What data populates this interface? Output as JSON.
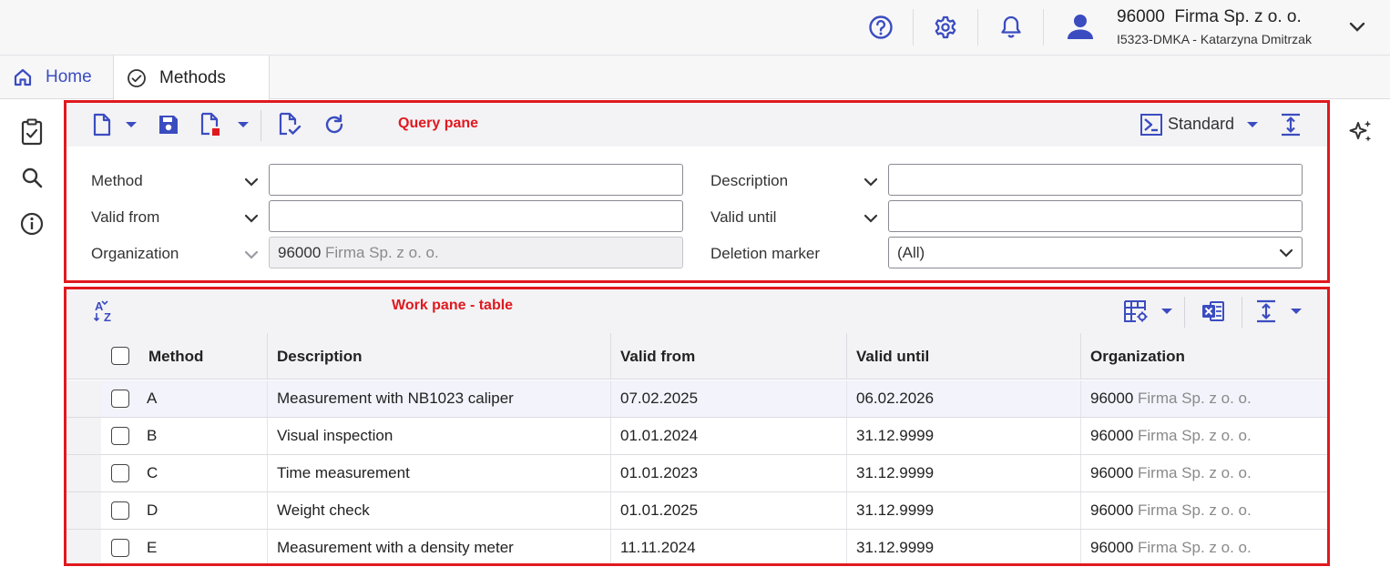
{
  "header": {
    "company": "96000  Firma Sp. z o. o.",
    "user": "I5323-DMKA - Katarzyna Dmitrzak",
    "icons": [
      "help-icon",
      "gear-icon",
      "bell-icon",
      "user-icon",
      "chevron-down-icon"
    ]
  },
  "tabs": [
    {
      "label": "Home",
      "icon": "home-icon"
    },
    {
      "label": "Methods",
      "icon": "check-circle-icon"
    }
  ],
  "rail": [
    "clipboard-check-icon",
    "search-icon",
    "info-icon"
  ],
  "query_pane": {
    "annotation": "Query pane",
    "view": "Standard",
    "fields": {
      "method": {
        "label": "Method",
        "value": ""
      },
      "valid_from": {
        "label": "Valid from",
        "value": ""
      },
      "organization": {
        "label": "Organization",
        "code": "96000",
        "name": "Firma Sp. z o. o."
      },
      "description": {
        "label": "Description",
        "value": ""
      },
      "valid_until": {
        "label": "Valid until",
        "value": ""
      },
      "deletion_marker": {
        "label": "Deletion marker",
        "value": "(All)"
      }
    }
  },
  "work_pane": {
    "annotation": "Work pane - table",
    "columns": [
      "Method",
      "Description",
      "Valid from",
      "Valid until",
      "Organization"
    ],
    "rows": [
      {
        "method": "A",
        "description": "Measurement with NB1023 caliper",
        "valid_from": "07.02.2025",
        "valid_until": "06.02.2026",
        "org_code": "96000",
        "org_name": "Firma Sp. z o. o."
      },
      {
        "method": "B",
        "description": "Visual inspection",
        "valid_from": "01.01.2024",
        "valid_until": "31.12.9999",
        "org_code": "96000",
        "org_name": "Firma Sp. z o. o."
      },
      {
        "method": "C",
        "description": "Time measurement",
        "valid_from": "01.01.2023",
        "valid_until": "31.12.9999",
        "org_code": "96000",
        "org_name": "Firma Sp. z o. o."
      },
      {
        "method": "D",
        "description": "Weight check",
        "valid_from": "01.01.2025",
        "valid_until": "31.12.9999",
        "org_code": "96000",
        "org_name": "Firma Sp. z o. o."
      },
      {
        "method": "E",
        "description": "Measurement with a density meter",
        "valid_from": "11.11.2024",
        "valid_until": "31.12.9999",
        "org_code": "96000",
        "org_name": "Firma Sp. z o. o."
      }
    ]
  },
  "colors": {
    "accent": "#3b4cc0",
    "annotation_red": "#e0191f"
  }
}
